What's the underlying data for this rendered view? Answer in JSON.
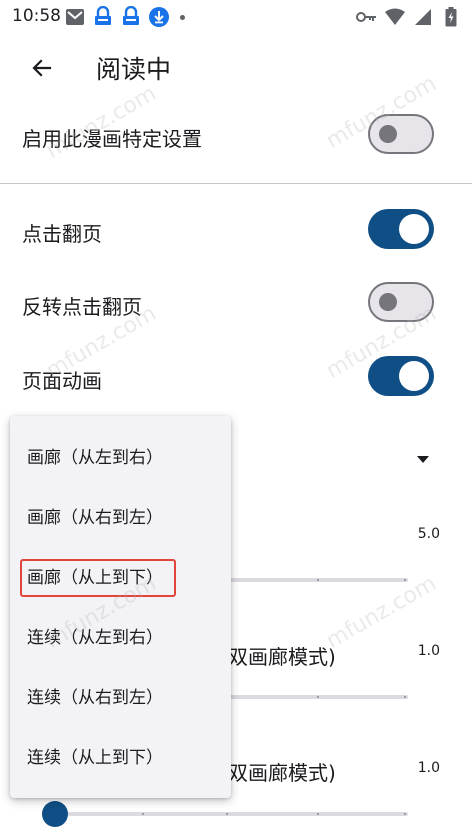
{
  "status_bar": {
    "time": "10:58",
    "left_icons": [
      "gmail-icon",
      "download-lock-icon",
      "download-lock-icon",
      "download-circle-icon",
      "dot-icon"
    ],
    "right_icons": [
      "vpn-key-icon",
      "wifi-icon",
      "signal-icon",
      "battery-icon"
    ]
  },
  "appbar": {
    "title": "阅读中"
  },
  "settings": {
    "specific_settings_label": "启用此漫画特定设置",
    "specific_settings_on": false,
    "tap_to_turn_label": "点击翻页",
    "tap_to_turn_on": true,
    "invert_tap_label": "反转点击翻页",
    "invert_tap_on": false,
    "page_animation_label": "页面动画",
    "page_animation_on": true
  },
  "background": {
    "value_1": "5.0",
    "value_2": "1.0",
    "label_2_partial": "双画廊模式)",
    "value_3": "1.0",
    "label_3_partial": "双画廊模式)"
  },
  "menu": {
    "items": [
      {
        "label": "画廊（从左到右）"
      },
      {
        "label": "画廊（从右到左）"
      },
      {
        "label": "画廊（从上到下）"
      },
      {
        "label": "连续（从左到右）"
      },
      {
        "label": "连续（从右到左）"
      },
      {
        "label": "连续（从上到下）"
      }
    ],
    "highlighted_index": 2
  },
  "colors": {
    "accent": "#0f4f85",
    "highlight": "#e0473a"
  }
}
